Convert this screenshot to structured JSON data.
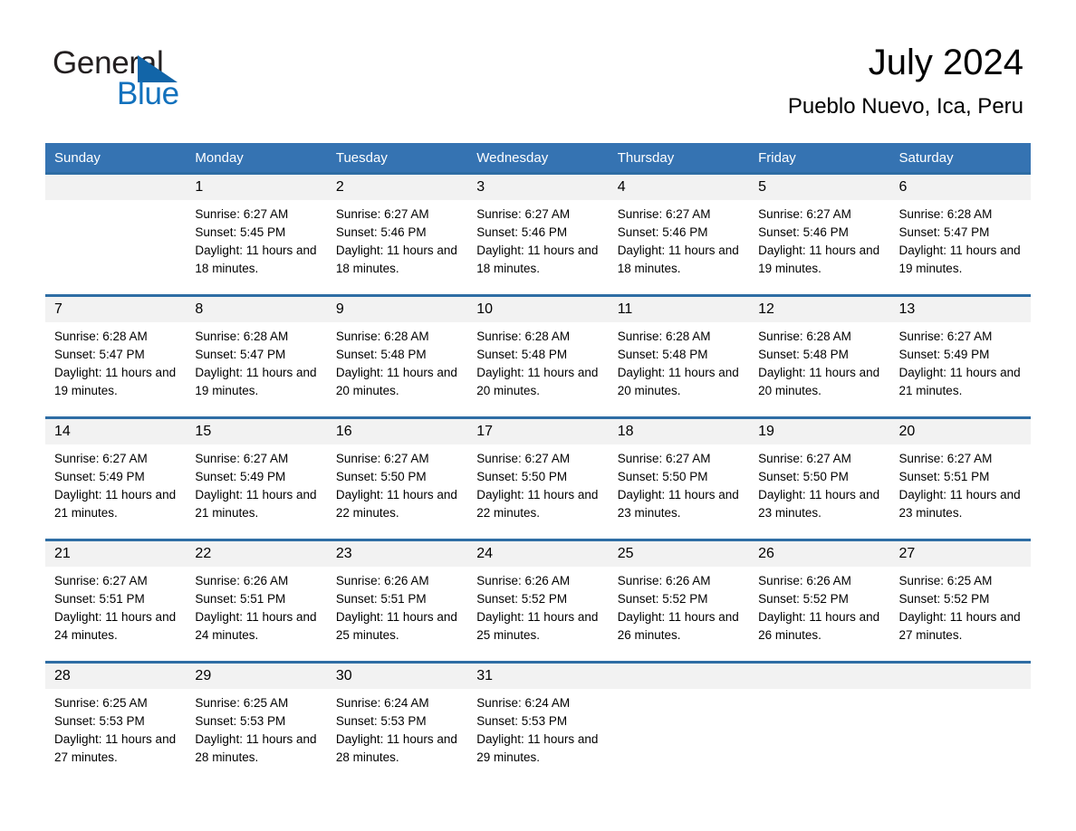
{
  "brand": {
    "logo_line1": "General",
    "logo_line2": "Blue",
    "triangle_icon": "triangle-icon",
    "colors": {
      "blue": "#1271bd",
      "triangle": "#1265a8",
      "dark": "#231f20"
    }
  },
  "header": {
    "title": "July 2024",
    "subtitle": "Pueblo Nuevo, Ica, Peru"
  },
  "theme": {
    "header_bg": "#3573b2",
    "row_divider": "#2e6da4",
    "daynum_band": "#f2f2f2",
    "page_bg": "#ffffff"
  },
  "calendar": {
    "weekday_headers": [
      "Sunday",
      "Monday",
      "Tuesday",
      "Wednesday",
      "Thursday",
      "Friday",
      "Saturday"
    ],
    "weeks": [
      [
        {
          "empty": true
        },
        {
          "day": "1",
          "sunrise": "Sunrise: 6:27 AM",
          "sunset": "Sunset: 5:45 PM",
          "daylight": "Daylight: 11 hours and 18 minutes."
        },
        {
          "day": "2",
          "sunrise": "Sunrise: 6:27 AM",
          "sunset": "Sunset: 5:46 PM",
          "daylight": "Daylight: 11 hours and 18 minutes."
        },
        {
          "day": "3",
          "sunrise": "Sunrise: 6:27 AM",
          "sunset": "Sunset: 5:46 PM",
          "daylight": "Daylight: 11 hours and 18 minutes."
        },
        {
          "day": "4",
          "sunrise": "Sunrise: 6:27 AM",
          "sunset": "Sunset: 5:46 PM",
          "daylight": "Daylight: 11 hours and 18 minutes."
        },
        {
          "day": "5",
          "sunrise": "Sunrise: 6:27 AM",
          "sunset": "Sunset: 5:46 PM",
          "daylight": "Daylight: 11 hours and 19 minutes."
        },
        {
          "day": "6",
          "sunrise": "Sunrise: 6:28 AM",
          "sunset": "Sunset: 5:47 PM",
          "daylight": "Daylight: 11 hours and 19 minutes."
        }
      ],
      [
        {
          "day": "7",
          "sunrise": "Sunrise: 6:28 AM",
          "sunset": "Sunset: 5:47 PM",
          "daylight": "Daylight: 11 hours and 19 minutes."
        },
        {
          "day": "8",
          "sunrise": "Sunrise: 6:28 AM",
          "sunset": "Sunset: 5:47 PM",
          "daylight": "Daylight: 11 hours and 19 minutes."
        },
        {
          "day": "9",
          "sunrise": "Sunrise: 6:28 AM",
          "sunset": "Sunset: 5:48 PM",
          "daylight": "Daylight: 11 hours and 20 minutes."
        },
        {
          "day": "10",
          "sunrise": "Sunrise: 6:28 AM",
          "sunset": "Sunset: 5:48 PM",
          "daylight": "Daylight: 11 hours and 20 minutes."
        },
        {
          "day": "11",
          "sunrise": "Sunrise: 6:28 AM",
          "sunset": "Sunset: 5:48 PM",
          "daylight": "Daylight: 11 hours and 20 minutes."
        },
        {
          "day": "12",
          "sunrise": "Sunrise: 6:28 AM",
          "sunset": "Sunset: 5:48 PM",
          "daylight": "Daylight: 11 hours and 20 minutes."
        },
        {
          "day": "13",
          "sunrise": "Sunrise: 6:27 AM",
          "sunset": "Sunset: 5:49 PM",
          "daylight": "Daylight: 11 hours and 21 minutes."
        }
      ],
      [
        {
          "day": "14",
          "sunrise": "Sunrise: 6:27 AM",
          "sunset": "Sunset: 5:49 PM",
          "daylight": "Daylight: 11 hours and 21 minutes."
        },
        {
          "day": "15",
          "sunrise": "Sunrise: 6:27 AM",
          "sunset": "Sunset: 5:49 PM",
          "daylight": "Daylight: 11 hours and 21 minutes."
        },
        {
          "day": "16",
          "sunrise": "Sunrise: 6:27 AM",
          "sunset": "Sunset: 5:50 PM",
          "daylight": "Daylight: 11 hours and 22 minutes."
        },
        {
          "day": "17",
          "sunrise": "Sunrise: 6:27 AM",
          "sunset": "Sunset: 5:50 PM",
          "daylight": "Daylight: 11 hours and 22 minutes."
        },
        {
          "day": "18",
          "sunrise": "Sunrise: 6:27 AM",
          "sunset": "Sunset: 5:50 PM",
          "daylight": "Daylight: 11 hours and 23 minutes."
        },
        {
          "day": "19",
          "sunrise": "Sunrise: 6:27 AM",
          "sunset": "Sunset: 5:50 PM",
          "daylight": "Daylight: 11 hours and 23 minutes."
        },
        {
          "day": "20",
          "sunrise": "Sunrise: 6:27 AM",
          "sunset": "Sunset: 5:51 PM",
          "daylight": "Daylight: 11 hours and 23 minutes."
        }
      ],
      [
        {
          "day": "21",
          "sunrise": "Sunrise: 6:27 AM",
          "sunset": "Sunset: 5:51 PM",
          "daylight": "Daylight: 11 hours and 24 minutes."
        },
        {
          "day": "22",
          "sunrise": "Sunrise: 6:26 AM",
          "sunset": "Sunset: 5:51 PM",
          "daylight": "Daylight: 11 hours and 24 minutes."
        },
        {
          "day": "23",
          "sunrise": "Sunrise: 6:26 AM",
          "sunset": "Sunset: 5:51 PM",
          "daylight": "Daylight: 11 hours and 25 minutes."
        },
        {
          "day": "24",
          "sunrise": "Sunrise: 6:26 AM",
          "sunset": "Sunset: 5:52 PM",
          "daylight": "Daylight: 11 hours and 25 minutes."
        },
        {
          "day": "25",
          "sunrise": "Sunrise: 6:26 AM",
          "sunset": "Sunset: 5:52 PM",
          "daylight": "Daylight: 11 hours and 26 minutes."
        },
        {
          "day": "26",
          "sunrise": "Sunrise: 6:26 AM",
          "sunset": "Sunset: 5:52 PM",
          "daylight": "Daylight: 11 hours and 26 minutes."
        },
        {
          "day": "27",
          "sunrise": "Sunrise: 6:25 AM",
          "sunset": "Sunset: 5:52 PM",
          "daylight": "Daylight: 11 hours and 27 minutes."
        }
      ],
      [
        {
          "day": "28",
          "sunrise": "Sunrise: 6:25 AM",
          "sunset": "Sunset: 5:53 PM",
          "daylight": "Daylight: 11 hours and 27 minutes."
        },
        {
          "day": "29",
          "sunrise": "Sunrise: 6:25 AM",
          "sunset": "Sunset: 5:53 PM",
          "daylight": "Daylight: 11 hours and 28 minutes."
        },
        {
          "day": "30",
          "sunrise": "Sunrise: 6:24 AM",
          "sunset": "Sunset: 5:53 PM",
          "daylight": "Daylight: 11 hours and 28 minutes."
        },
        {
          "day": "31",
          "sunrise": "Sunrise: 6:24 AM",
          "sunset": "Sunset: 5:53 PM",
          "daylight": "Daylight: 11 hours and 29 minutes."
        },
        {
          "empty": true
        },
        {
          "empty": true
        },
        {
          "empty": true
        }
      ]
    ]
  }
}
